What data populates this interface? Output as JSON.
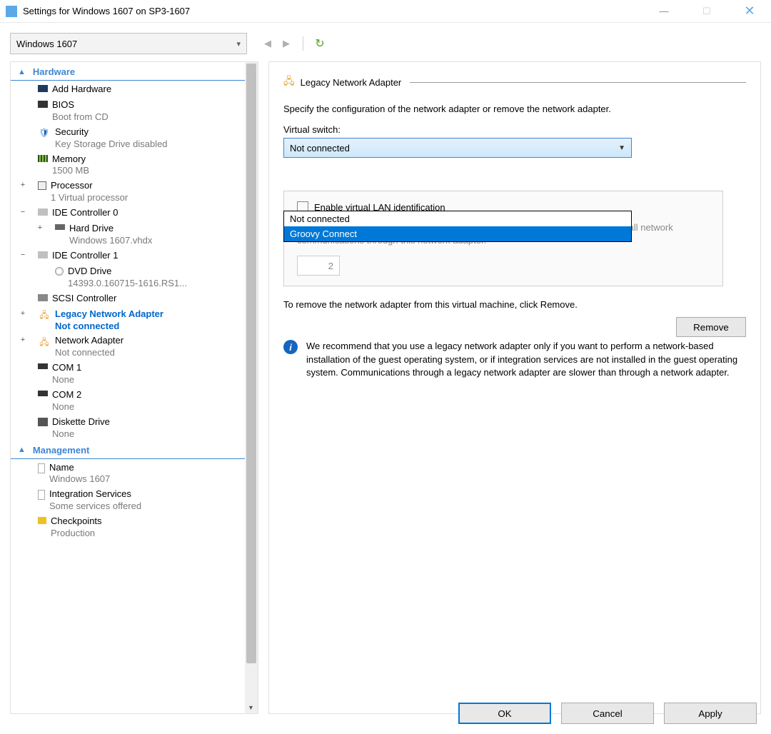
{
  "window": {
    "title": "Settings for Windows 1607 on SP3-1607"
  },
  "vm_selector": {
    "value": "Windows 1607"
  },
  "sidebar": {
    "sections": {
      "hardware": "Hardware",
      "management": "Management"
    },
    "items": [
      {
        "icon": "monitor",
        "label": "Add Hardware"
      },
      {
        "icon": "bios",
        "label": "BIOS",
        "sub": "Boot from CD"
      },
      {
        "icon": "shield",
        "label": "Security",
        "sub": "Key Storage Drive disabled"
      },
      {
        "icon": "mem",
        "label": "Memory",
        "sub": "1500 MB"
      },
      {
        "icon": "cpu",
        "label": "Processor",
        "sub": "1 Virtual processor",
        "expand": "+"
      },
      {
        "icon": "ide",
        "label": "IDE Controller 0",
        "expand": "−"
      },
      {
        "icon": "hdd",
        "label": "Hard Drive",
        "sub": "Windows 1607.vhdx",
        "child": true,
        "expand": "+"
      },
      {
        "icon": "ide",
        "label": "IDE Controller 1",
        "expand": "−"
      },
      {
        "icon": "dvd",
        "label": "DVD Drive",
        "sub": "14393.0.160715-1616.RS1...",
        "child": true
      },
      {
        "icon": "scsi",
        "label": "SCSI Controller"
      },
      {
        "icon": "nic",
        "label": "Legacy Network Adapter",
        "sub": "Not connected",
        "selected": true,
        "expand": "+"
      },
      {
        "icon": "nic",
        "label": "Network Adapter",
        "sub": "Not connected",
        "expand": "+"
      },
      {
        "icon": "com",
        "label": "COM 1",
        "sub": "None"
      },
      {
        "icon": "com",
        "label": "COM 2",
        "sub": "None"
      },
      {
        "icon": "disk",
        "label": "Diskette Drive",
        "sub": "None"
      }
    ],
    "mgmt_items": [
      {
        "icon": "doc",
        "label": "Name",
        "sub": "Windows 1607"
      },
      {
        "icon": "doc",
        "label": "Integration Services",
        "sub": "Some services offered"
      },
      {
        "icon": "chk",
        "label": "Checkpoints",
        "sub": "Production"
      }
    ]
  },
  "panel": {
    "title": "Legacy Network Adapter",
    "desc": "Specify the configuration of the network adapter or remove the network adapter.",
    "switch_label": "Virtual switch:",
    "switch_value": "Not connected",
    "dropdown": [
      {
        "label": "Not connected",
        "hover": false
      },
      {
        "label": "Groovy Connect",
        "hover": true
      }
    ],
    "vlan_check": "Enable virtual LAN identification",
    "vlan_desc": "The VLAN identifier specifies the virtual LAN that this virtual machine will use for all network communications through this network adapter.",
    "vlan_value": "2",
    "remove_text": "To remove the network adapter from this virtual machine, click Remove.",
    "remove_btn": "Remove",
    "info": "We recommend that you use a legacy network adapter only if you want to perform a network-based installation of the guest operating system, or if integration services are not installed in the guest operating system. Communications through a legacy network adapter are slower than through a network adapter."
  },
  "buttons": {
    "ok": "OK",
    "cancel": "Cancel",
    "apply": "Apply"
  }
}
